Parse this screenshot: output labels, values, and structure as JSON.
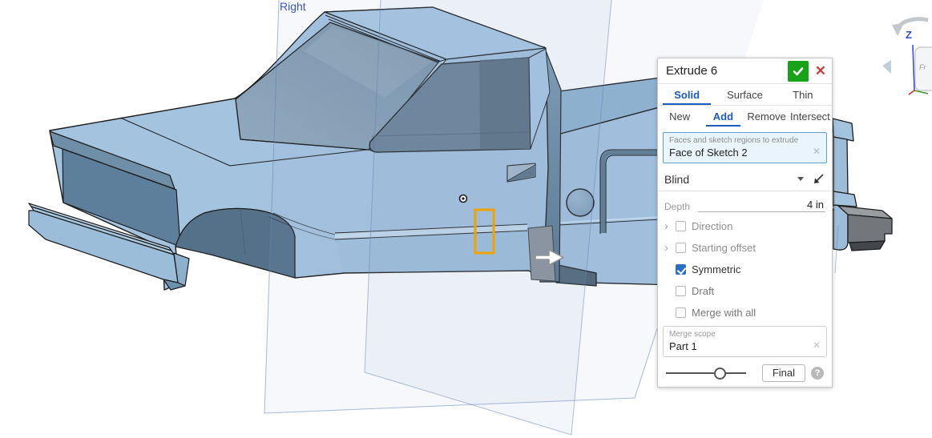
{
  "viewport": {
    "plane_label": "Right",
    "view_cube": {
      "z": "Z",
      "front": "Fr"
    },
    "colors": {
      "body_blue": "#a4c3df",
      "dark_face": "#5d7f9c",
      "selection_orange": "#f0a202",
      "plane_edge_blue": "#7e9cc9",
      "rear_bumper_gray": "#73777b"
    }
  },
  "dialog": {
    "title": "Extrude 6",
    "confirm_icon": "check",
    "cancel_icon": "x",
    "tabs_primary": [
      {
        "label": "Solid",
        "active": true
      },
      {
        "label": "Surface",
        "active": false
      },
      {
        "label": "Thin",
        "active": false
      }
    ],
    "tabs_boolean": [
      {
        "label": "New",
        "active": false
      },
      {
        "label": "Add",
        "active": true
      },
      {
        "label": "Remove",
        "active": false
      },
      {
        "label": "Intersect",
        "active": false
      }
    ],
    "faces_field": {
      "label": "Faces and sketch regions to extrude",
      "value": "Face of Sketch 2"
    },
    "end_condition": "Blind",
    "depth": {
      "label": "Depth",
      "value": "4 in"
    },
    "options": [
      {
        "label": "Direction",
        "checked": false,
        "expandable": true
      },
      {
        "label": "Starting offset",
        "checked": false,
        "expandable": true
      },
      {
        "label": "Symmetric",
        "checked": true,
        "expandable": false
      },
      {
        "label": "Draft",
        "checked": false,
        "expandable": false
      },
      {
        "label": "Merge with all",
        "checked": false,
        "expandable": false
      }
    ],
    "merge_scope": {
      "label": "Merge scope",
      "value": "Part 1"
    },
    "final_button": "Final",
    "accent_blue": "#1b5bbd",
    "confirm_green": "#17a217",
    "cancel_red": "#c4403a"
  }
}
